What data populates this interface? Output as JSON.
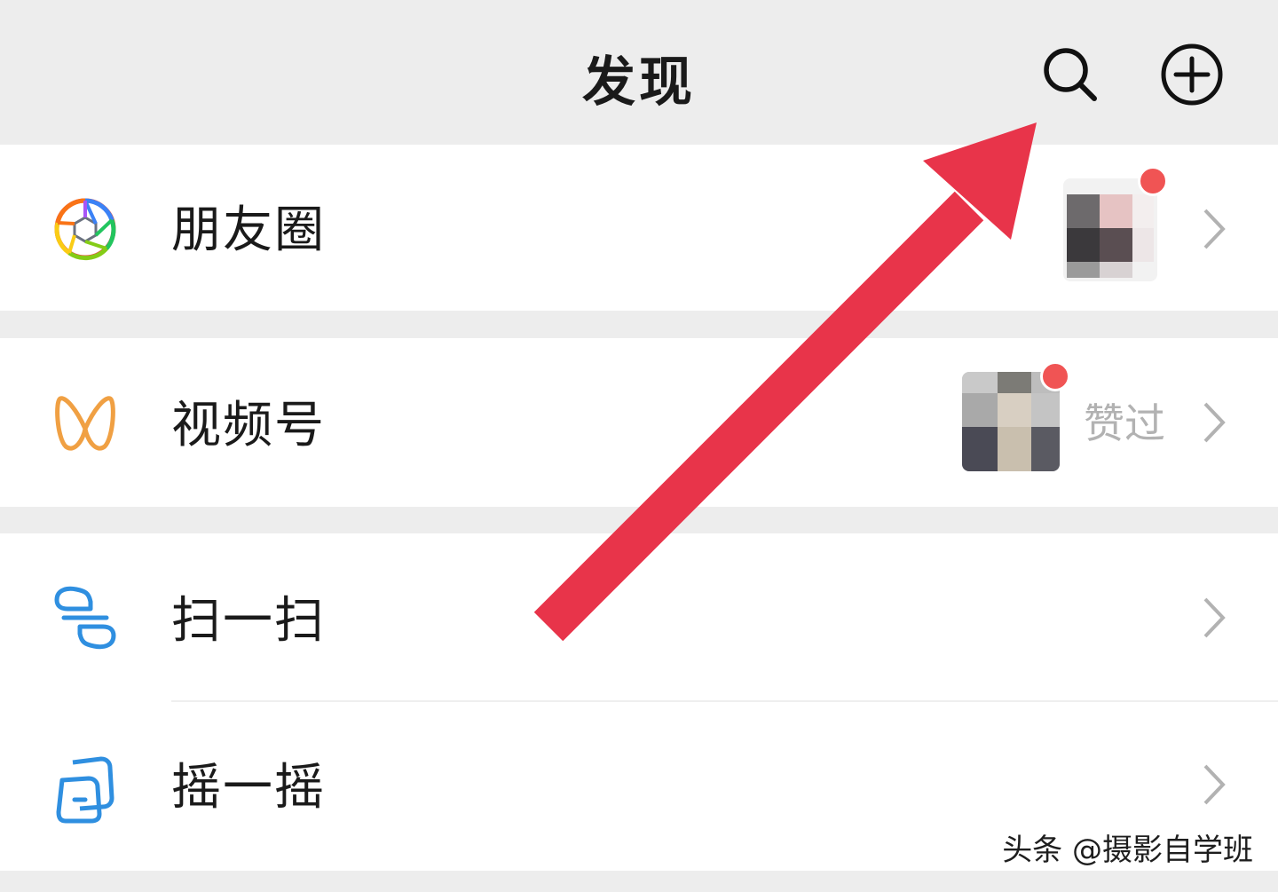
{
  "header": {
    "title": "发现",
    "search_icon": "search-icon",
    "add_icon": "plus-circle-icon"
  },
  "rows": [
    {
      "id": "moments",
      "label": "朋友圈",
      "icon": "aperture-icon",
      "has_thumbnail": true,
      "has_red_dot": true
    },
    {
      "id": "channels",
      "label": "视频号",
      "icon": "channels-butterfly-icon",
      "has_thumbnail": true,
      "has_red_dot": true,
      "status_text": "赞过"
    },
    {
      "id": "scan",
      "label": "扫一扫",
      "icon": "scan-icon"
    },
    {
      "id": "shake",
      "label": "摇一摇",
      "icon": "shake-icon"
    }
  ],
  "overlay": {
    "arrow_color": "#e8344a",
    "arrow_target": "search-icon"
  },
  "watermark": "头条 @摄影自学班",
  "colors": {
    "background": "#ededed",
    "row_background": "#ffffff",
    "red_dot": "#f05454",
    "chevron": "#b2b2b2",
    "channels_icon": "#f0a043",
    "scan_icon": "#2f8fe0"
  }
}
